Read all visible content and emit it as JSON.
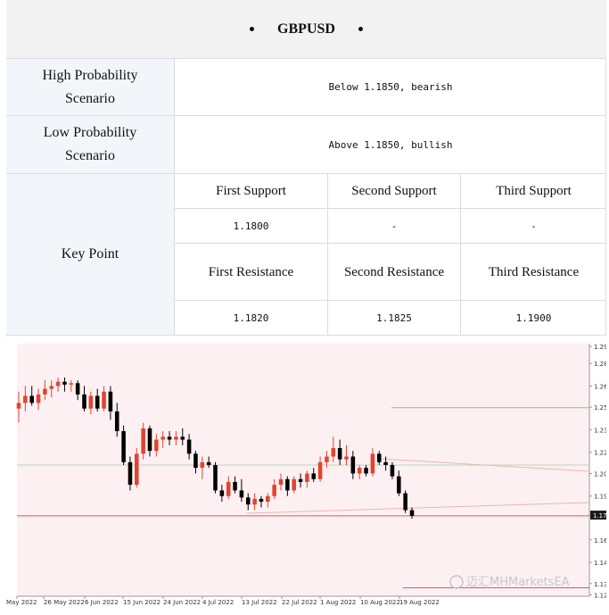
{
  "title": "GBPUSD",
  "scenarios": {
    "high_label": "High Probability Scenario",
    "high_value": "Below 1.1850, bearish",
    "low_label": "Low Probability Scenario",
    "low_value": "Above 1.1850, bullish"
  },
  "key_point": {
    "label": "Key Point",
    "support_headers": [
      "First Support",
      "Second Support",
      "Third Support"
    ],
    "support_values": [
      "1.1800",
      "-",
      "-"
    ],
    "resistance_headers": [
      "First Resistance",
      "Second Resistance",
      "Third Resistance"
    ],
    "resistance_values": [
      "1.1820",
      "1.1825",
      "1.1900"
    ]
  },
  "chart_data": {
    "type": "candlestick",
    "x_tick_labels": [
      "May 2022",
      "26 May 2022",
      "6 Jun 2022",
      "15 Jun 2022",
      "24 Jun 2022",
      "4 Jul 2022",
      "13 Jul 2022",
      "22 Jul 2022",
      "1 Aug 2022",
      "10 Aug 2022",
      "19 Aug 2022"
    ],
    "y_tick_labels": [
      "1.29",
      "1.28",
      "1.26",
      "1.25",
      "1.23",
      "1.22",
      "1.20",
      "1.19",
      "1.17",
      "1.16",
      "1.14",
      "1.13",
      "1.12"
    ],
    "ylim": [
      1.113,
      1.292
    ],
    "current_price_label": "1.17",
    "current_price": 1.1705,
    "horizontal_levels": [
      {
        "value": 1.2466,
        "color": "#7fc97f"
      },
      {
        "value": 1.206,
        "color": "#b6ddb2"
      },
      {
        "value": 1.17,
        "color": "#e25555"
      },
      {
        "value": 1.119,
        "color": "#e25555"
      }
    ],
    "bull_color": "#e0452f",
    "bear_color": "#000000",
    "candles": [
      {
        "o": 1.246,
        "h": 1.258,
        "l": 1.236,
        "c": 1.25
      },
      {
        "o": 1.25,
        "h": 1.262,
        "l": 1.244,
        "c": 1.255
      },
      {
        "o": 1.255,
        "h": 1.262,
        "l": 1.248,
        "c": 1.25
      },
      {
        "o": 1.25,
        "h": 1.26,
        "l": 1.245,
        "c": 1.256
      },
      {
        "o": 1.256,
        "h": 1.266,
        "l": 1.252,
        "c": 1.26
      },
      {
        "o": 1.26,
        "h": 1.266,
        "l": 1.254,
        "c": 1.262
      },
      {
        "o": 1.262,
        "h": 1.268,
        "l": 1.258,
        "c": 1.265
      },
      {
        "o": 1.265,
        "h": 1.268,
        "l": 1.258,
        "c": 1.263
      },
      {
        "o": 1.263,
        "h": 1.266,
        "l": 1.258,
        "c": 1.264
      },
      {
        "o": 1.264,
        "h": 1.266,
        "l": 1.252,
        "c": 1.256
      },
      {
        "o": 1.256,
        "h": 1.262,
        "l": 1.244,
        "c": 1.246
      },
      {
        "o": 1.246,
        "h": 1.258,
        "l": 1.242,
        "c": 1.255
      },
      {
        "o": 1.255,
        "h": 1.26,
        "l": 1.244,
        "c": 1.246
      },
      {
        "o": 1.246,
        "h": 1.262,
        "l": 1.244,
        "c": 1.258
      },
      {
        "o": 1.258,
        "h": 1.262,
        "l": 1.238,
        "c": 1.244
      },
      {
        "o": 1.244,
        "h": 1.25,
        "l": 1.226,
        "c": 1.23
      },
      {
        "o": 1.23,
        "h": 1.234,
        "l": 1.206,
        "c": 1.208
      },
      {
        "o": 1.208,
        "h": 1.212,
        "l": 1.188,
        "c": 1.192
      },
      {
        "o": 1.192,
        "h": 1.218,
        "l": 1.19,
        "c": 1.214
      },
      {
        "o": 1.214,
        "h": 1.236,
        "l": 1.21,
        "c": 1.232
      },
      {
        "o": 1.232,
        "h": 1.234,
        "l": 1.212,
        "c": 1.216
      },
      {
        "o": 1.216,
        "h": 1.228,
        "l": 1.212,
        "c": 1.224
      },
      {
        "o": 1.224,
        "h": 1.23,
        "l": 1.218,
        "c": 1.226
      },
      {
        "o": 1.226,
        "h": 1.23,
        "l": 1.22,
        "c": 1.224
      },
      {
        "o": 1.224,
        "h": 1.23,
        "l": 1.22,
        "c": 1.226
      },
      {
        "o": 1.226,
        "h": 1.232,
        "l": 1.22,
        "c": 1.224
      },
      {
        "o": 1.224,
        "h": 1.228,
        "l": 1.21,
        "c": 1.214
      },
      {
        "o": 1.214,
        "h": 1.216,
        "l": 1.2,
        "c": 1.204
      },
      {
        "o": 1.204,
        "h": 1.212,
        "l": 1.196,
        "c": 1.208
      },
      {
        "o": 1.208,
        "h": 1.212,
        "l": 1.204,
        "c": 1.206
      },
      {
        "o": 1.206,
        "h": 1.208,
        "l": 1.186,
        "c": 1.188
      },
      {
        "o": 1.188,
        "h": 1.192,
        "l": 1.18,
        "c": 1.184
      },
      {
        "o": 1.184,
        "h": 1.198,
        "l": 1.182,
        "c": 1.194
      },
      {
        "o": 1.194,
        "h": 1.198,
        "l": 1.186,
        "c": 1.188
      },
      {
        "o": 1.188,
        "h": 1.196,
        "l": 1.18,
        "c": 1.183
      },
      {
        "o": 1.183,
        "h": 1.186,
        "l": 1.174,
        "c": 1.178
      },
      {
        "o": 1.178,
        "h": 1.186,
        "l": 1.174,
        "c": 1.182
      },
      {
        "o": 1.182,
        "h": 1.184,
        "l": 1.176,
        "c": 1.18
      },
      {
        "o": 1.18,
        "h": 1.186,
        "l": 1.176,
        "c": 1.184
      },
      {
        "o": 1.184,
        "h": 1.196,
        "l": 1.182,
        "c": 1.192
      },
      {
        "o": 1.192,
        "h": 1.2,
        "l": 1.188,
        "c": 1.196
      },
      {
        "o": 1.196,
        "h": 1.198,
        "l": 1.184,
        "c": 1.188
      },
      {
        "o": 1.188,
        "h": 1.198,
        "l": 1.186,
        "c": 1.196
      },
      {
        "o": 1.196,
        "h": 1.2,
        "l": 1.19,
        "c": 1.194
      },
      {
        "o": 1.194,
        "h": 1.202,
        "l": 1.19,
        "c": 1.2
      },
      {
        "o": 1.2,
        "h": 1.204,
        "l": 1.194,
        "c": 1.196
      },
      {
        "o": 1.196,
        "h": 1.212,
        "l": 1.194,
        "c": 1.208
      },
      {
        "o": 1.208,
        "h": 1.216,
        "l": 1.204,
        "c": 1.212
      },
      {
        "o": 1.212,
        "h": 1.226,
        "l": 1.208,
        "c": 1.218
      },
      {
        "o": 1.218,
        "h": 1.224,
        "l": 1.206,
        "c": 1.21
      },
      {
        "o": 1.21,
        "h": 1.22,
        "l": 1.206,
        "c": 1.212
      },
      {
        "o": 1.212,
        "h": 1.216,
        "l": 1.196,
        "c": 1.2
      },
      {
        "o": 1.2,
        "h": 1.206,
        "l": 1.196,
        "c": 1.204
      },
      {
        "o": 1.204,
        "h": 1.206,
        "l": 1.198,
        "c": 1.2
      },
      {
        "o": 1.2,
        "h": 1.218,
        "l": 1.198,
        "c": 1.214
      },
      {
        "o": 1.214,
        "h": 1.216,
        "l": 1.206,
        "c": 1.208
      },
      {
        "o": 1.208,
        "h": 1.212,
        "l": 1.202,
        "c": 1.206
      },
      {
        "o": 1.206,
        "h": 1.208,
        "l": 1.196,
        "c": 1.198
      },
      {
        "o": 1.198,
        "h": 1.202,
        "l": 1.184,
        "c": 1.186
      },
      {
        "o": 1.186,
        "h": 1.188,
        "l": 1.172,
        "c": 1.174
      },
      {
        "o": 1.174,
        "h": 1.176,
        "l": 1.168,
        "c": 1.17
      }
    ],
    "watermark": "迈汇MHMarketsEA"
  }
}
